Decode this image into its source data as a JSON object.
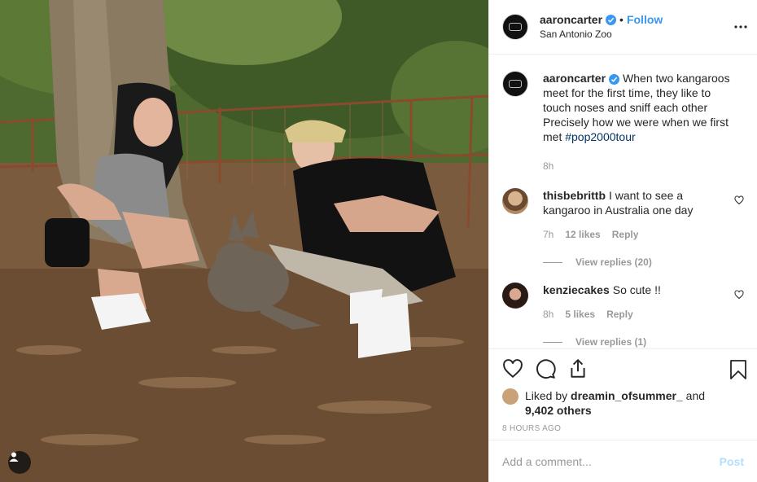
{
  "colors": {
    "accent": "#3897f0",
    "text": "#262626",
    "muted": "#999999",
    "post_disabled": "#b2dffc"
  },
  "header": {
    "username": "aaroncarter",
    "separator": "•",
    "follow_label": "Follow",
    "location": "San Antonio Zoo",
    "more_icon": "more-horizontal-icon"
  },
  "caption": {
    "username": "aaroncarter",
    "text": "When two kangaroos meet for the first time, they like to touch noses and sniff each other Precisely how we were when we first met ",
    "hashtag": "#pop2000tour",
    "time": "8h"
  },
  "comments": [
    {
      "username": "thisbebrittb",
      "text": "I want to see a kangaroo in Australia one day",
      "time": "7h",
      "likes": "12 likes",
      "reply": "Reply",
      "view_replies": "View replies (20)"
    },
    {
      "username": "kenziecakes",
      "text": "So cute !!",
      "time": "8h",
      "likes": "5 likes",
      "reply": "Reply",
      "view_replies": "View replies (1)"
    }
  ],
  "likes": {
    "prefix": "Liked by",
    "user": "dreamin_ofsummer_",
    "and": "and",
    "others": "9,402 others"
  },
  "time_ago": "8 HOURS AGO",
  "add_comment": {
    "placeholder": "Add a comment...",
    "post_label": "Post"
  }
}
